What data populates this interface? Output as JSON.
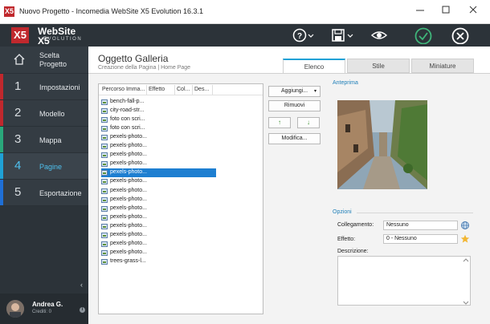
{
  "window": {
    "title": "Nuovo Progetto - Incomedia WebSite X5 Evolution 16.3.1",
    "app_icon": "X5"
  },
  "logo": {
    "mark": "X5",
    "name": "WebSite X5",
    "edition": "EVOLUTION"
  },
  "sidebar": {
    "home_label_line1": "Scelta",
    "home_label_line2": "Progetto",
    "items": [
      {
        "num": "1",
        "label": "Impostazioni",
        "color": "#c0282d"
      },
      {
        "num": "2",
        "label": "Modello",
        "color": "#c0282d"
      },
      {
        "num": "3",
        "label": "Mappa",
        "color": "#2aa87b"
      },
      {
        "num": "4",
        "label": "Pagine",
        "color": "#1fa1d6"
      },
      {
        "num": "5",
        "label": "Esportazione",
        "color": "#1f6fd6"
      }
    ],
    "collapse": "‹",
    "user": {
      "name": "Andrea G.",
      "credit": "Crediti: 0",
      "info": "i"
    }
  },
  "content": {
    "title": "Oggetto Galleria",
    "breadcrumb": "Creazione della Pagina | Home Page",
    "tabs": [
      "Elenco",
      "Stile",
      "Miniature"
    ]
  },
  "list": {
    "columns": [
      "Percorso Imma...",
      "Effetto",
      "Col...",
      "Des..."
    ],
    "items": [
      "bench-fall-p...",
      "city-road-str...",
      "foto con scri...",
      "foto con scri...",
      "pexels-photo...",
      "pexels-photo...",
      "pexels-photo...",
      "pexels-photo...",
      "pexels-photo...",
      "pexels-photo...",
      "pexels-photo...",
      "pexels-photo...",
      "pexels-photo...",
      "pexels-photo...",
      "pexels-photo...",
      "pexels-photo...",
      "pexels-photo...",
      "pexels-photo...",
      "trees-grass-l..."
    ],
    "selected_index": 8
  },
  "actions": {
    "add": "Aggiungi...",
    "add_caret": "▾",
    "remove": "Rimuovi",
    "up": "↑",
    "down": "↓",
    "edit": "Modifica..."
  },
  "preview": {
    "label": "Anteprima"
  },
  "options": {
    "label": "Opzioni",
    "link_label": "Collegamento:",
    "link_value": "Nessuno",
    "effect_label": "Effetto:",
    "effect_value": "0 - Nessuno",
    "description_label": "Descrizione:"
  },
  "colors": {
    "accent": "#1fa1d6",
    "sidebar_bg": "#2c3339",
    "brand_red": "#c0282d",
    "check_green": "#3fb57a"
  }
}
